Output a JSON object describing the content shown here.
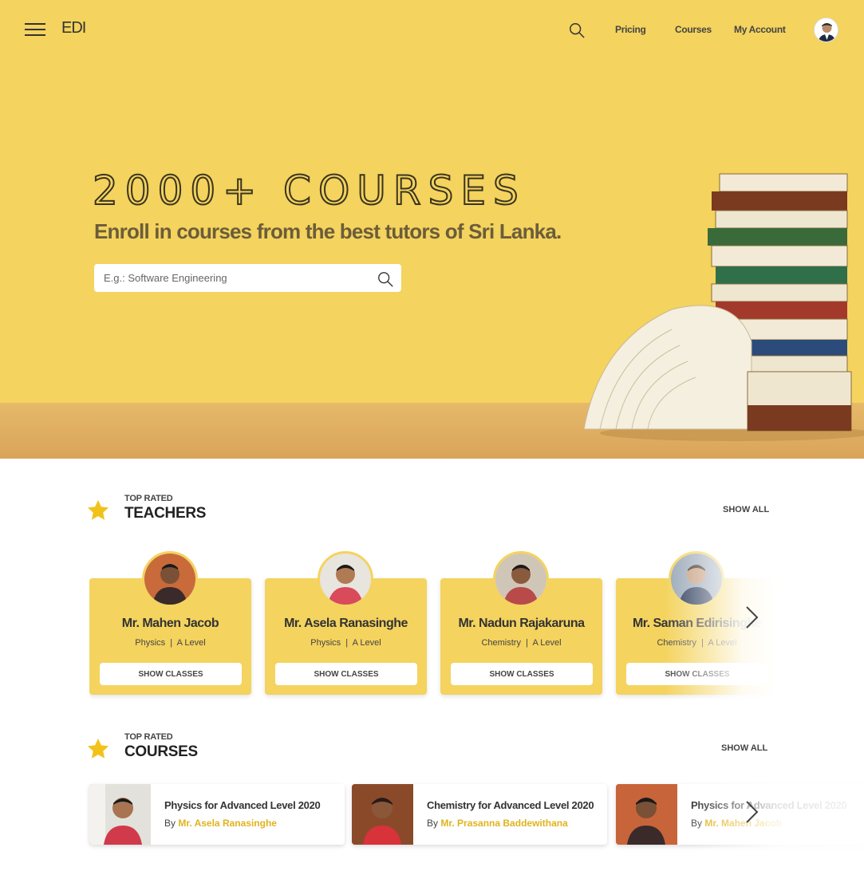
{
  "header": {
    "logo": "EDI",
    "nav": [
      "Pricing",
      "Courses",
      "My Account"
    ]
  },
  "hero": {
    "title": "2000+ COURSES",
    "subtitle": "Enroll in courses from the best tutors of Sri Lanka.",
    "search_placeholder": "E.g.: Software Engineering"
  },
  "teachers_section": {
    "small": "TOP RATED",
    "big": "TEACHERS",
    "show_all": "SHOW ALL",
    "teachers": [
      {
        "name": "Mr. Mahen Jacob",
        "subject": "Physics",
        "level": "A Level",
        "button": "SHOW CLASSES"
      },
      {
        "name": "Mr. Asela Ranasinghe",
        "subject": "Physics",
        "level": "A Level",
        "button": "SHOW CLASSES"
      },
      {
        "name": "Mr. Nadun Rajakaruna",
        "subject": "Chemistry",
        "level": "A Level",
        "button": "SHOW CLASSES"
      },
      {
        "name": "Mr. Saman Edirisinghe",
        "subject": "Chemistry",
        "level": "A Level",
        "button": "SHOW CLASSES"
      }
    ]
  },
  "courses_section": {
    "small": "TOP RATED",
    "big": "COURSES",
    "show_all": "SHOW ALL",
    "courses": [
      {
        "title": "Physics for Advanced Level 2020",
        "by": "By",
        "tutor": "Mr. Asela Ranasinghe"
      },
      {
        "title": "Chemistry for Advanced Level 2020",
        "by": "By",
        "tutor": "Mr. Prasanna Baddewithana"
      },
      {
        "title": "Physics for Advanced Level 2020",
        "by": "By",
        "tutor": "Mr. Mahen Jacob"
      }
    ]
  },
  "colors": {
    "brand_yellow": "#f4d35e",
    "accent_gold": "#e0b31d"
  }
}
